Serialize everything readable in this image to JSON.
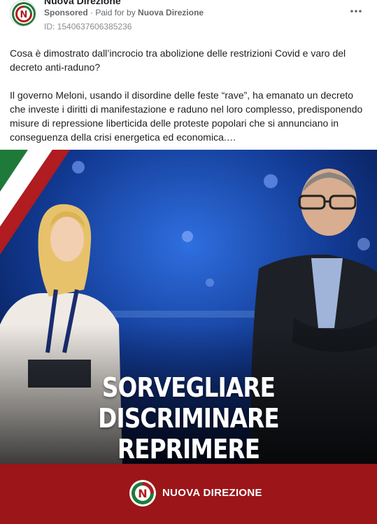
{
  "post": {
    "page_name": "Nuova Direzione",
    "sponsored_label": "Sponsored",
    "separator": " · ",
    "paid_for_prefix": "Paid for by ",
    "paid_for_by": "Nuova Direzione",
    "ad_id": "ID: 1540637606385236",
    "more_icon": "more-horizontal-icon",
    "paragraph_1": "Cosa è dimostrato dall’incrocio tra abolizione delle restrizioni Covid e varo del decreto anti-raduno?",
    "paragraph_2": "Il governo Meloni, usando il disordine delle feste “rave”, ha emanato un decreto che investe i diritti di manifestazione e raduno nel loro complesso, predisponendo misure di repressione liberticida delle proteste popolari che si annunciano in conseguenza della crisi energetica ed economica.…"
  },
  "ad_image": {
    "headline_lines": [
      "SORVEGLIARE",
      "DISCRIMINARE",
      "REPRIMERE"
    ],
    "brand_name": "NUOVA DIREZIONE",
    "logo_letter": "N",
    "colors": {
      "green": "#1f7a3a",
      "red": "#b01c1f",
      "brand_bar": "#9b1519",
      "stage_blue": "#0d2a73"
    }
  }
}
